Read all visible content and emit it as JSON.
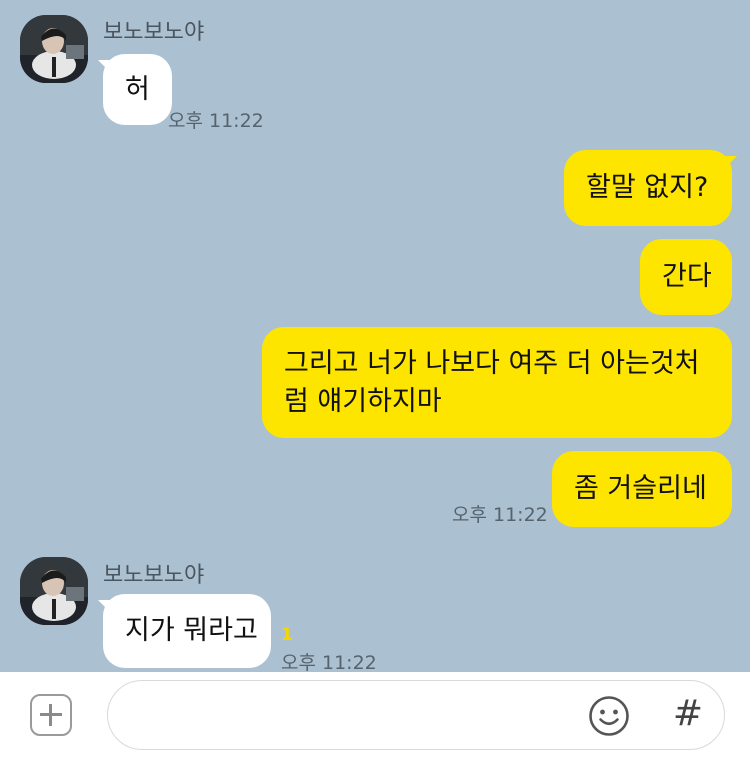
{
  "messages": [
    {
      "sender": "보노보노야",
      "text": "허",
      "time": "오후 11:22"
    },
    {
      "text": "할말 없지?"
    },
    {
      "text": "간다"
    },
    {
      "text": "그리고 너가 나보다 여주 더 아는것처럼 얘기하지마"
    },
    {
      "text": "좀 거슬리네",
      "time": "오후 11:22"
    },
    {
      "sender": "보노보노야",
      "text": "지가 뭐라고",
      "unread": "1",
      "time": "오후 11:22"
    }
  ],
  "input": {
    "placeholder": "",
    "plus_icon": "plus-box-icon",
    "emoji_icon": "smiley-icon",
    "hash_label": "#"
  },
  "colors": {
    "background": "#abc1d1",
    "outgoing_bubble": "#fee500",
    "incoming_bubble": "#ffffff",
    "unread_count": "#f5d600"
  }
}
